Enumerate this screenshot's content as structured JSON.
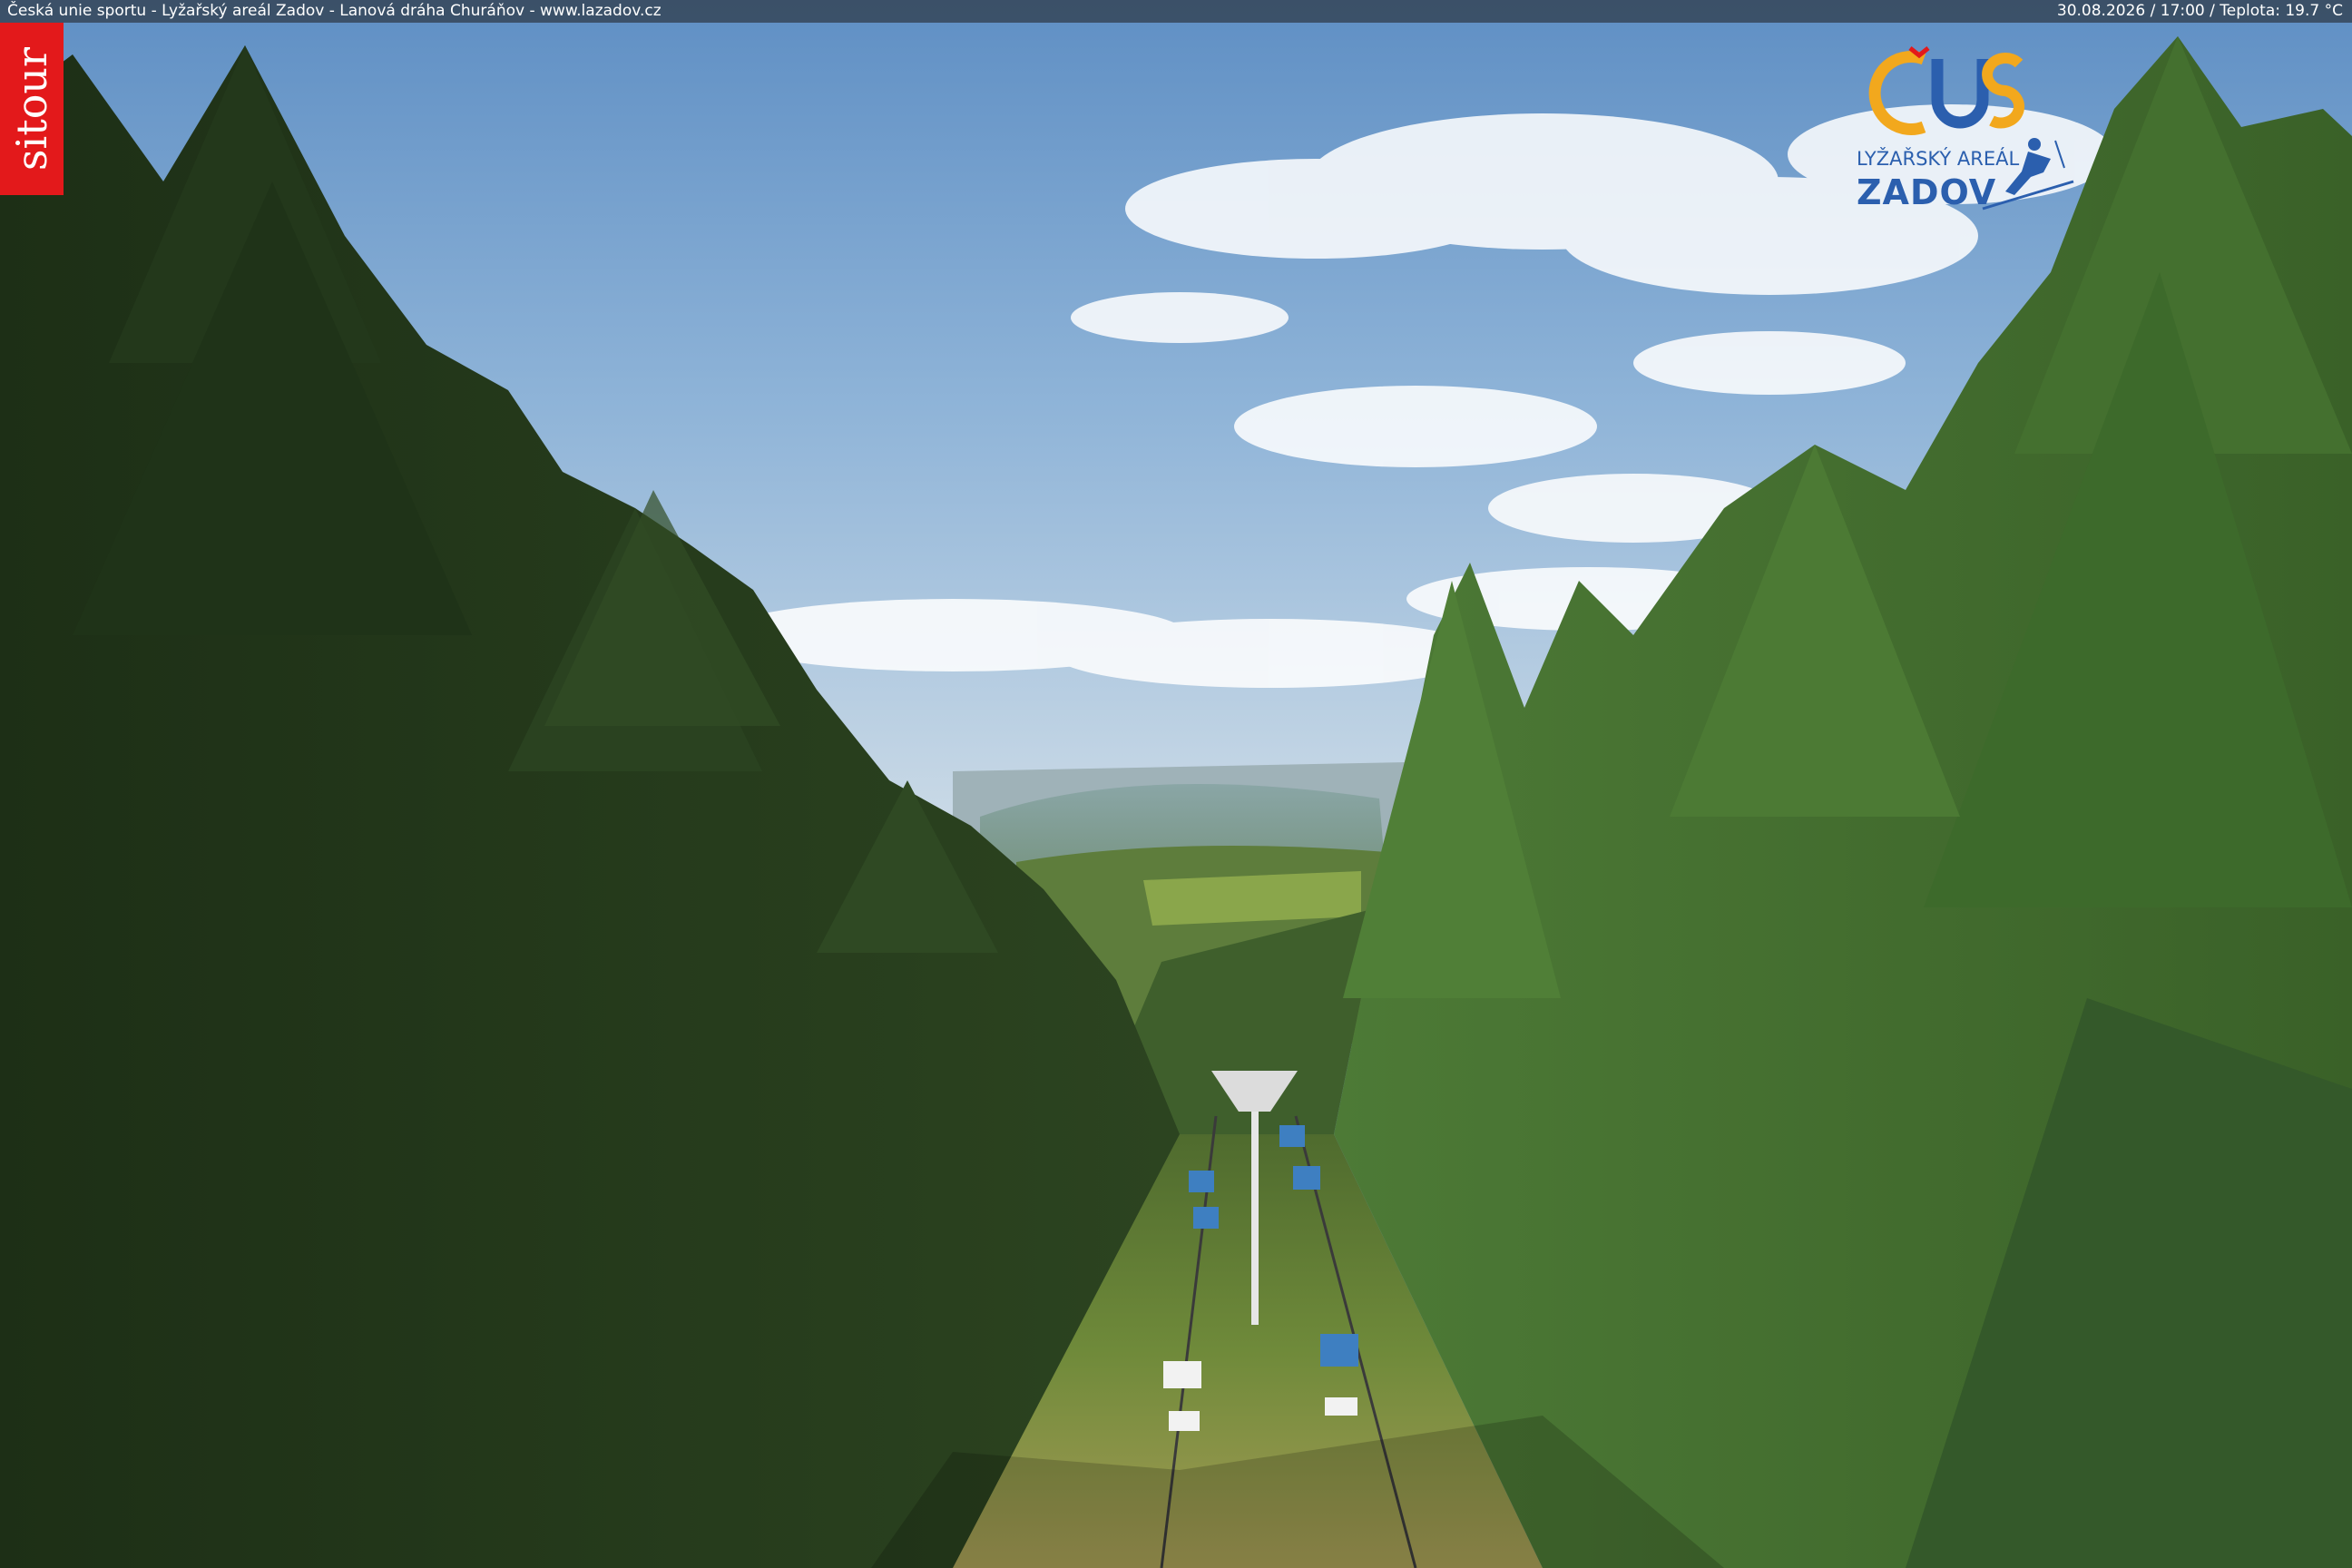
{
  "overlay": {
    "left_caption": "Česká unie sportu - Lyžařský areál Zadov - Lanová dráha Churáňov - www.lazadov.cz",
    "right_caption": "30.08.2026 / 17:00 / Teplota: 19.7 °C"
  },
  "branding": {
    "sitour_label": "sitour",
    "sitour_color": "#e3191b",
    "logo_letters": "ČUS",
    "logo_line1": "LYŽAŘSKÝ AREÁL",
    "logo_line2": "ZADOV",
    "logo_colors": [
      "#f2a81d",
      "#2b5fae",
      "#e3191b"
    ]
  },
  "scene": {
    "description_icons": [
      "spruce-forest",
      "chairlift",
      "sky-clouds",
      "valley-landscape"
    ],
    "sky_color": "#6f9cc9",
    "forest_color": "#2f4a26"
  }
}
